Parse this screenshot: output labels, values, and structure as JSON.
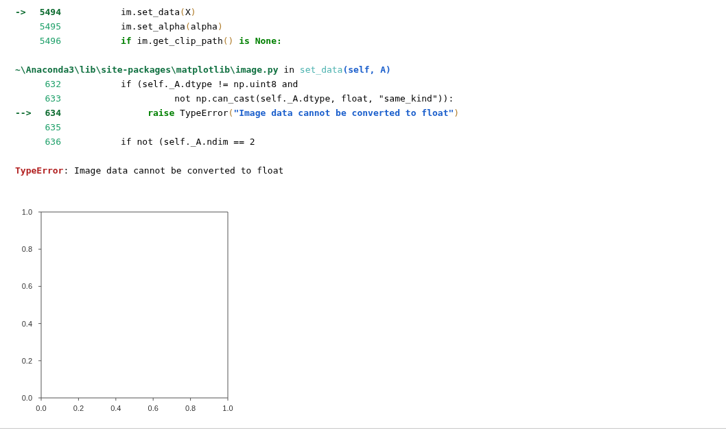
{
  "traceback": [
    {
      "kind": "code",
      "lines": [
        {
          "arrow": "->",
          "number": "5494",
          "current": true,
          "tokens": [
            {
              "text": "im.set_data",
              "kind": "plain"
            },
            {
              "text": "(",
              "kind": "paren"
            },
            {
              "text": "X",
              "kind": "plain"
            },
            {
              "text": ")",
              "kind": "paren"
            }
          ]
        },
        {
          "number": "5495",
          "current": false,
          "tokens": [
            {
              "text": "im.set_alpha",
              "kind": "plain"
            },
            {
              "text": "(",
              "kind": "paren"
            },
            {
              "text": "alpha",
              "kind": "plain"
            },
            {
              "text": ")",
              "kind": "paren"
            }
          ]
        },
        {
          "number": "5496",
          "current": false,
          "tokens": [
            {
              "text": "if",
              "kind": "keyword"
            },
            {
              "text": " im.get_clip_path",
              "kind": "plain"
            },
            {
              "text": "()",
              "kind": "paren"
            },
            {
              "text": " is None:",
              "kind": "keyword"
            }
          ]
        }
      ]
    },
    {
      "kind": "header",
      "tokens": [
        {
          "text": "~\\Anaconda3\\lib\\site-packages\\matplotlib\\image.py",
          "kind": "path"
        },
        {
          "text": " in ",
          "kind": "plain"
        },
        {
          "text": "set_data",
          "kind": "function"
        },
        {
          "text": "(self, A)",
          "kind": "args"
        }
      ]
    },
    {
      "kind": "code",
      "lines": [
        {
          "number": "632",
          "current": false,
          "tokens": [
            {
              "text": "if (self._A.dtype != np.uint8 and",
              "kind": "plain"
            }
          ]
        },
        {
          "number": "633",
          "current": false,
          "tokens": [
            {
              "text": "          not np.can_cast(self._A.dtype, float, \"same_kind\")):",
              "kind": "plain"
            }
          ]
        },
        {
          "arrow": "-->",
          "number": "634",
          "current": true,
          "tokens": [
            {
              "text": "     raise",
              "kind": "keyword"
            },
            {
              "text": " TypeError",
              "kind": "plain"
            },
            {
              "text": "(",
              "kind": "paren"
            },
            {
              "text": "\"Image data cannot be converted to float\"",
              "kind": "string"
            },
            {
              "text": ")",
              "kind": "paren"
            }
          ]
        },
        {
          "number": "635",
          "current": false
        },
        {
          "number": "636",
          "current": false,
          "tokens": [
            {
              "text": "if not (self._A.ndim == 2",
              "kind": "plain"
            }
          ]
        }
      ]
    },
    {
      "kind": "error",
      "tokens": [
        {
          "text": "TypeError",
          "kind": "error"
        },
        {
          "text": ": Image data cannot be converted to float",
          "kind": "plain"
        }
      ]
    }
  ],
  "figure": {
    "chart_data": {
      "type": "line",
      "xlim": [
        0,
        1
      ],
      "ylim": [
        0,
        1
      ],
      "xticks": [
        {
          "value": 0,
          "label": "0.0"
        },
        {
          "value": 0.2,
          "label": "0.2"
        },
        {
          "value": 0.4,
          "label": "0.4"
        },
        {
          "value": 0.6,
          "label": "0.6"
        },
        {
          "value": 0.8,
          "label": "0.8"
        },
        {
          "value": 1,
          "label": "1.0"
        }
      ],
      "yticks": [
        {
          "value": 0,
          "label": "0.0"
        },
        {
          "value": 0.2,
          "label": "0.2"
        },
        {
          "value": 0.4,
          "label": "0.4"
        },
        {
          "value": 0.6,
          "label": "0.6"
        },
        {
          "value": 0.8,
          "label": "0.8"
        },
        {
          "value": 1,
          "label": "1.0"
        }
      ]
    }
  }
}
